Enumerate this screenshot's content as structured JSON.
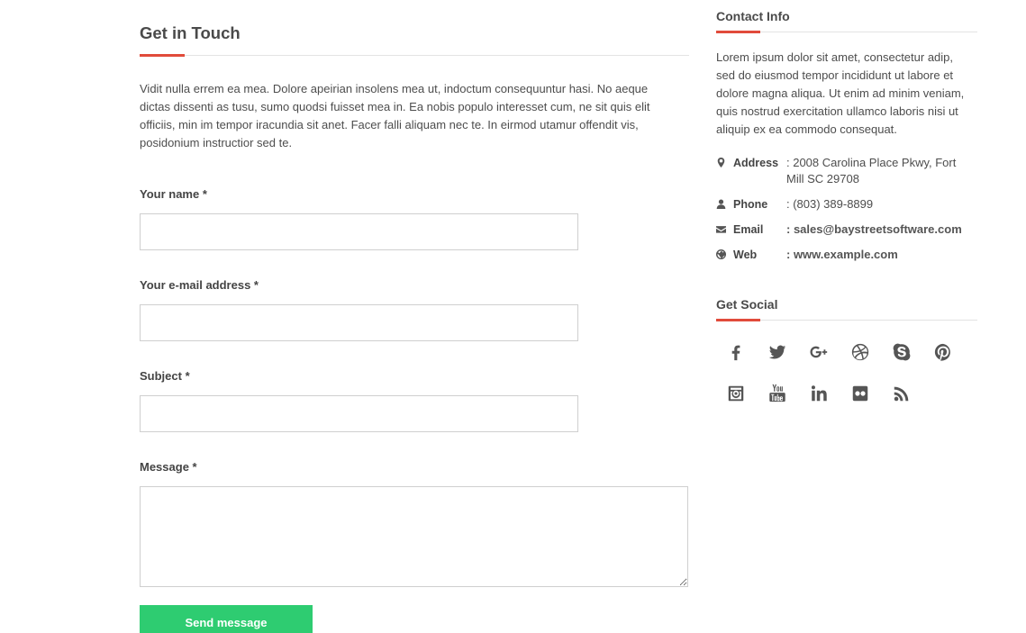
{
  "main": {
    "title": "Get in Touch",
    "intro": "Vidit nulla errem ea mea. Dolore apeirian insolens mea ut, indoctum consequuntur hasi. No aeque dictas dissenti as tusu, sumo quodsi fuisset mea in. Ea nobis populo interesset cum, ne sit quis elit officiis, min im tempor iracundia sit anet. Facer falli aliquam nec te. In eirmod utamur offendit vis, posidonium instructior sed te.",
    "form": {
      "name_label": "Your name *",
      "name_value": "",
      "email_label": "Your e-mail address *",
      "email_value": "",
      "subject_label": "Subject *",
      "subject_value": "",
      "message_label": "Message *",
      "message_value": "",
      "submit_label": "Send message"
    }
  },
  "sidebar": {
    "contact_title": "Contact Info",
    "about": "Lorem ipsum dolor sit amet, consectetur adip, sed do eiusmod tempor incididunt ut labore et dolore magna aliqua. Ut enim ad minim veniam, quis nostrud exercitation ullamco laboris nisi ut aliquip ex ea commodo consequat.",
    "contacts": [
      {
        "icon": "map-marker-icon",
        "label": "Address",
        "value": ": 2008 Carolina Place Pkwy, Fort Mill SC 29708"
      },
      {
        "icon": "user-icon",
        "label": "Phone",
        "value": ": (803) 389-8899"
      },
      {
        "icon": "envelope-icon",
        "label": "Email",
        "value": ": sales@baystreetsoftware.com"
      },
      {
        "icon": "globe-icon",
        "label": "Web",
        "value": ": www.example.com"
      }
    ],
    "social_title": "Get Social",
    "social_icons": [
      "facebook-icon",
      "twitter-icon",
      "google-plus-icon",
      "dribbble-icon",
      "skype-icon",
      "pinterest-icon",
      "instagram-icon",
      "youtube-icon",
      "linkedin-icon",
      "flickr-icon",
      "rss-icon"
    ]
  },
  "colors": {
    "accent": "#e14b3b",
    "button": "#2ecc71",
    "text": "#4d4d4d"
  }
}
